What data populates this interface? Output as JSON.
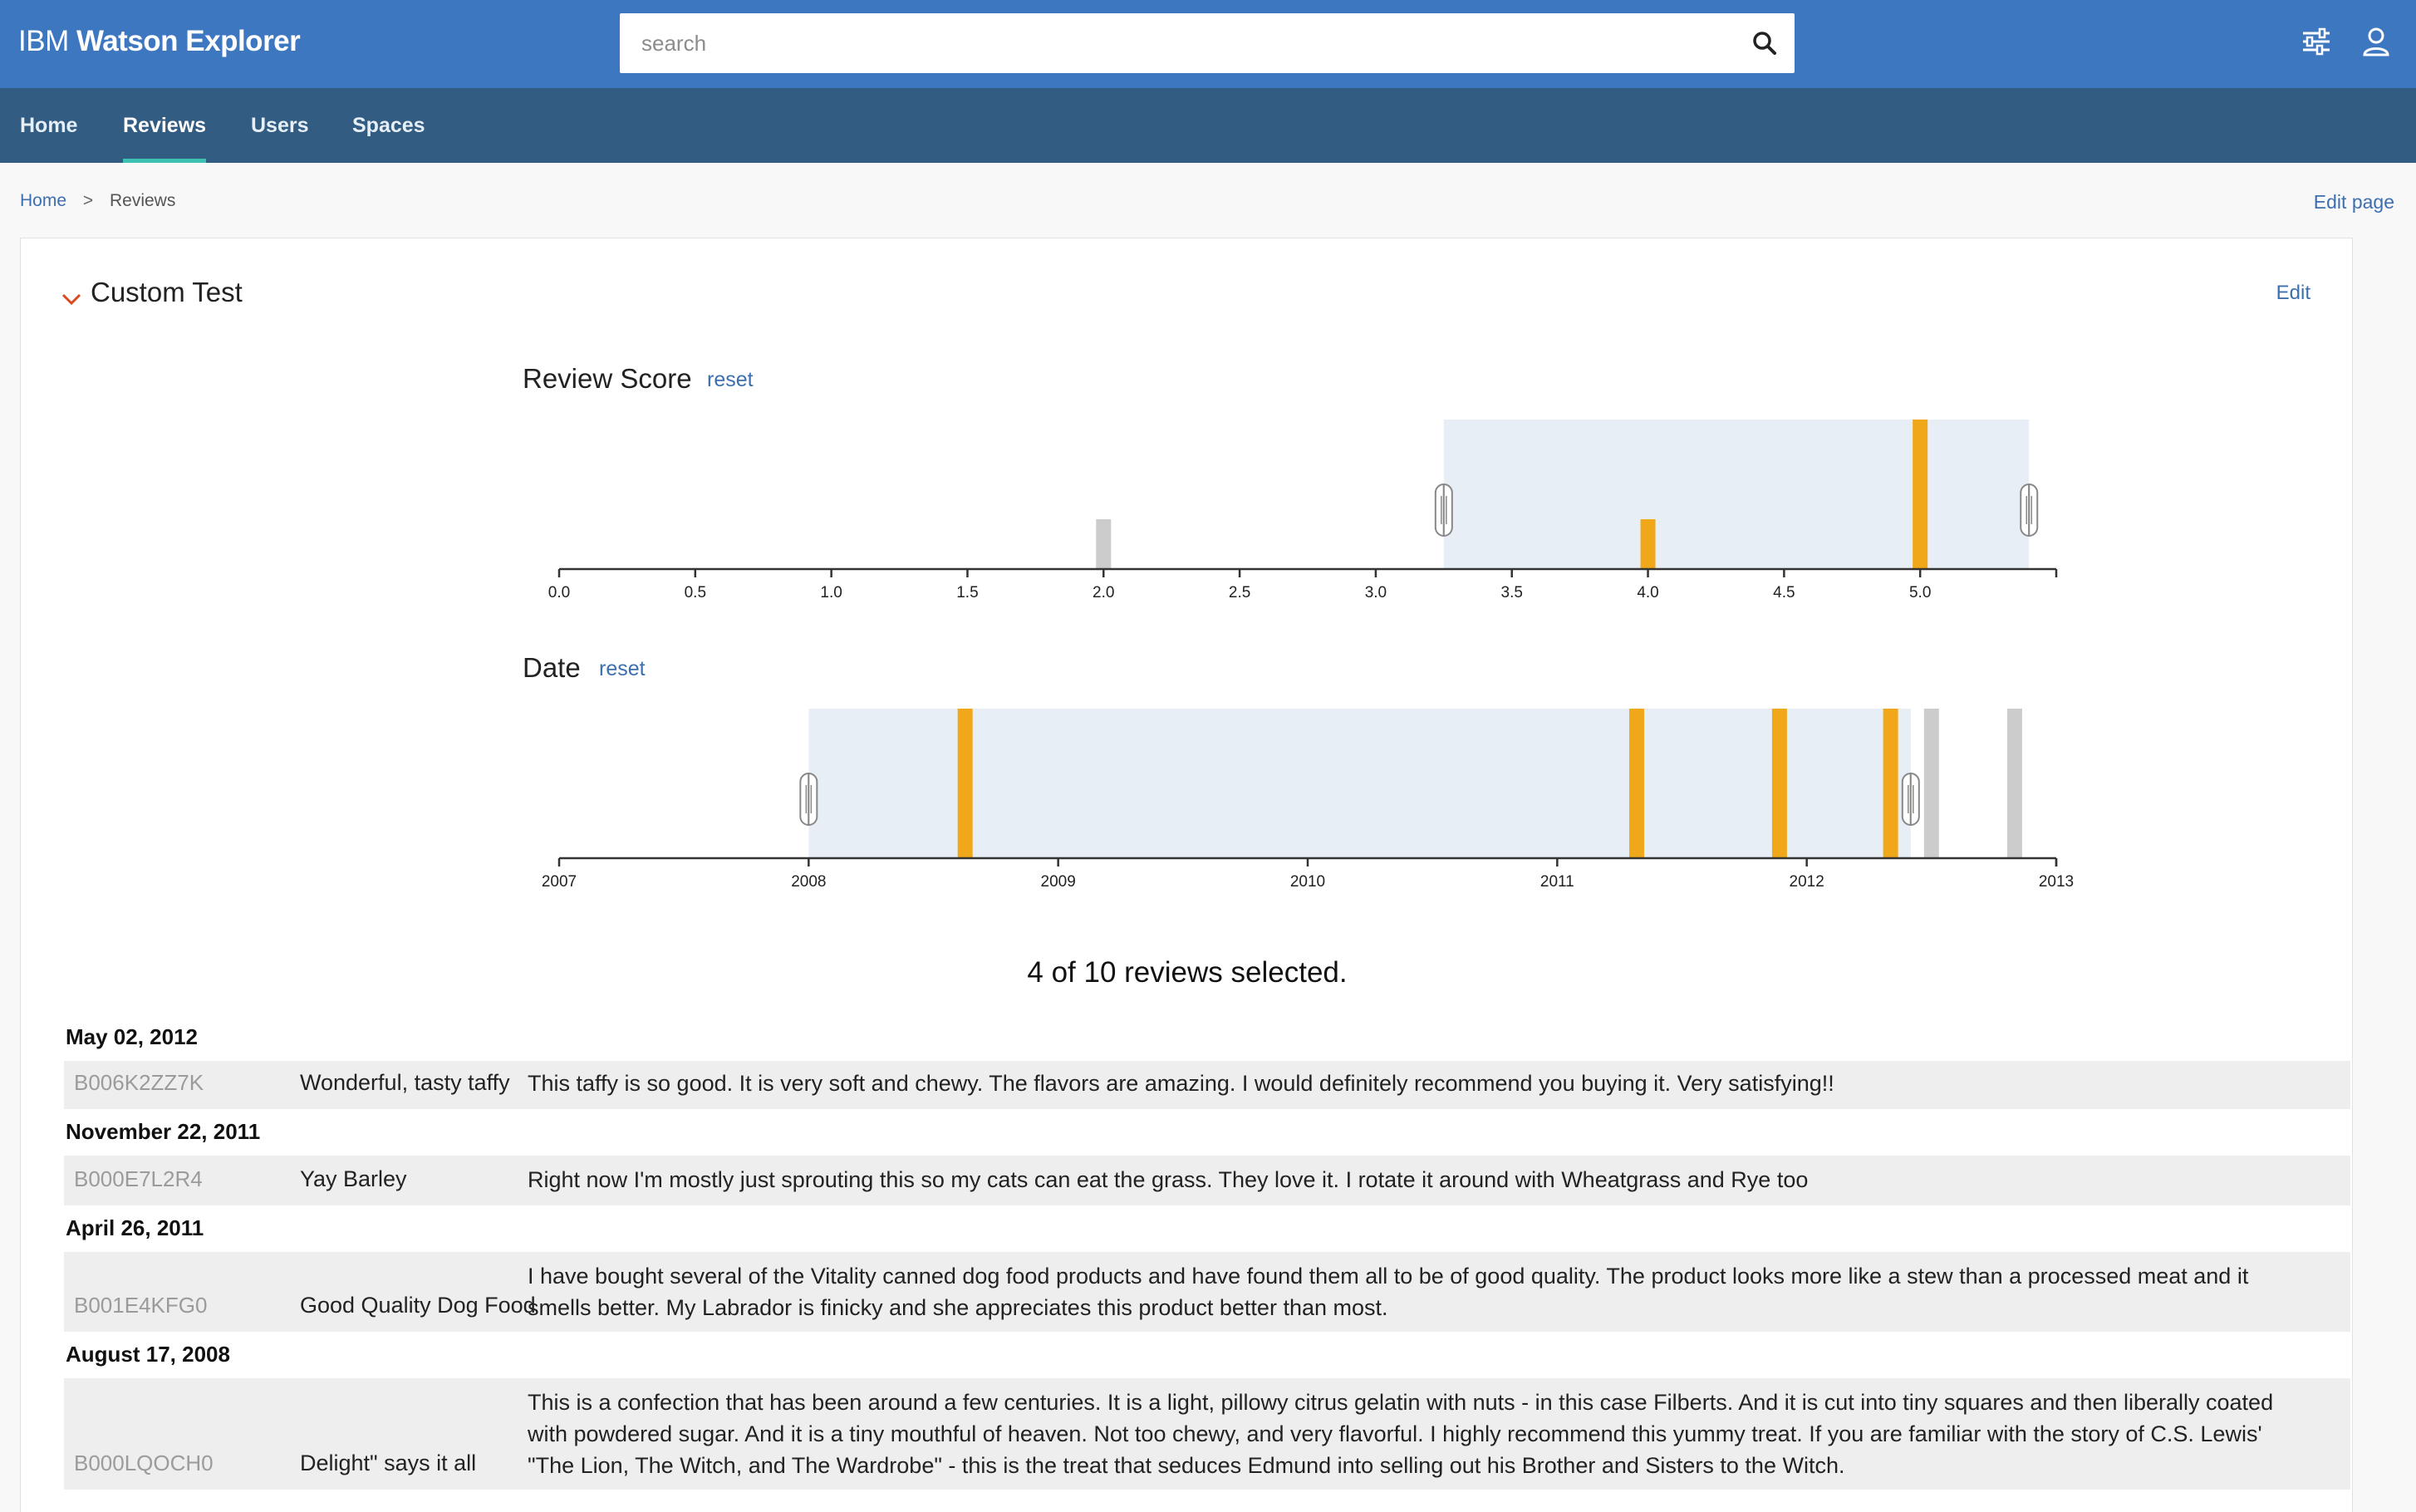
{
  "app": {
    "brand_prefix": "IBM",
    "brand_name": "Watson Explorer"
  },
  "search": {
    "placeholder": "search"
  },
  "nav": {
    "items": [
      {
        "label": "Home",
        "active": false
      },
      {
        "label": "Reviews",
        "active": true
      },
      {
        "label": "Users",
        "active": false
      },
      {
        "label": "Spaces",
        "active": false
      }
    ]
  },
  "breadcrumb": {
    "home": "Home",
    "separator": ">",
    "current": "Reviews"
  },
  "page": {
    "edit_label": "Edit page"
  },
  "card": {
    "title": "Custom Test",
    "edit_label": "Edit"
  },
  "chart_data": [
    {
      "type": "bar",
      "title": "Review Score",
      "reset_label": "reset",
      "xlim": [
        0,
        5.5
      ],
      "ticks": [
        "0.0",
        "0.5",
        "1.0",
        "1.5",
        "2.0",
        "2.5",
        "3.0",
        "3.5",
        "4.0",
        "4.5",
        "5.0"
      ],
      "bars": [
        {
          "x": 2.0,
          "count": 1,
          "selected": false
        },
        {
          "x": 4.0,
          "count": 1,
          "selected": true
        },
        {
          "x": 5.0,
          "count": 3,
          "selected": true
        }
      ],
      "brush": [
        3.25,
        5.4
      ],
      "colors": {
        "selected": "#f0a81a",
        "unselected": "#cccccc",
        "brush": "#e8eef5"
      }
    },
    {
      "type": "bar",
      "title": "Date",
      "reset_label": "reset",
      "xlim": [
        2007,
        2013
      ],
      "ticks": [
        "2007",
        "2008",
        "2009",
        "2010",
        "2011",
        "2012",
        "2013"
      ],
      "bars": [
        {
          "x": "2008-08-17",
          "count": 1,
          "selected": true
        },
        {
          "x": "2011-04-26",
          "count": 1,
          "selected": true
        },
        {
          "x": "2011-11-22",
          "count": 1,
          "selected": true
        },
        {
          "x": "2012-05-02",
          "count": 1,
          "selected": true
        },
        {
          "x": "2012-07",
          "count": 1,
          "selected": false
        },
        {
          "x": "2012-11",
          "count": 1,
          "selected": false
        }
      ],
      "brush": [
        "2008-01-01",
        "2012-06-01"
      ],
      "colors": {
        "selected": "#f0a81a",
        "unselected": "#cccccc",
        "brush": "#e8eef5"
      }
    }
  ],
  "summary": "4 of 10 reviews selected.",
  "reviews": [
    {
      "date": "May 02, 2012",
      "id": "B006K2ZZ7K",
      "title": "Wonderful, tasty taffy",
      "text": "This taffy is so good. It is very soft and chewy. The flavors are amazing. I would definitely recommend you buying it. Very satisfying!!"
    },
    {
      "date": "November 22, 2011",
      "id": "B000E7L2R4",
      "title": "Yay Barley",
      "text": "Right now I'm mostly just sprouting this so my cats can eat the grass. They love it. I rotate it around with Wheatgrass and Rye too"
    },
    {
      "date": "April 26, 2011",
      "id": "B001E4KFG0",
      "title": "Good Quality Dog Food",
      "text": "I have bought several of the Vitality canned dog food products and have found them all to be of good quality. The product looks more like a stew than a processed meat and it smells better. My Labrador is finicky and she appreciates this product better than most."
    },
    {
      "date": "August 17, 2008",
      "id": "B000LQOCH0",
      "title": "Delight\" says it all",
      "text": "This is a confection that has been around a few centuries. It is a light, pillowy citrus gelatin with nuts - in this case Filberts. And it is cut into tiny squares and then liberally coated with powdered sugar. And it is a tiny mouthful of heaven. Not too chewy, and very flavorful. I highly recommend this yummy treat. If you are familiar with the story of C.S. Lewis' \"The Lion, The Witch, and The Wardrobe\" - this is the treat that seduces Edmund into selling out his Brother and Sisters to the Witch."
    }
  ]
}
